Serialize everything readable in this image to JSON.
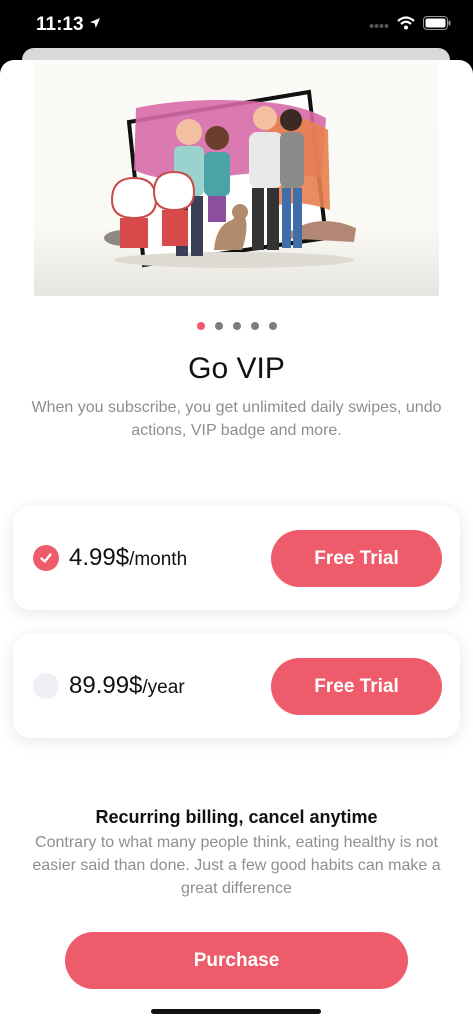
{
  "status_bar": {
    "time": "11:13"
  },
  "carousel": {
    "page_count": 5,
    "active_index": 0
  },
  "title": "Go VIP",
  "subtitle": "When you subscribe, you get unlimited daily swipes, undo actions, VIP badge and more.",
  "plans": [
    {
      "price": "4.99$",
      "period": "/month",
      "selected": true,
      "button_label": "Free Trial"
    },
    {
      "price": "89.99$",
      "period": "/year",
      "selected": false,
      "button_label": "Free Trial"
    }
  ],
  "billing": {
    "title": "Recurring billing, cancel anytime",
    "description": "Contrary to what many people think, eating healthy is not easier said than done. Just a few good habits can make a great difference"
  },
  "purchase_label": "Purchase",
  "colors": {
    "accent": "#ee5c6b",
    "muted_text": "#8e8e93"
  },
  "icons": [
    "location-arrow-icon",
    "cellular-signal-icon",
    "wifi-icon",
    "battery-icon",
    "checkmark-icon"
  ]
}
